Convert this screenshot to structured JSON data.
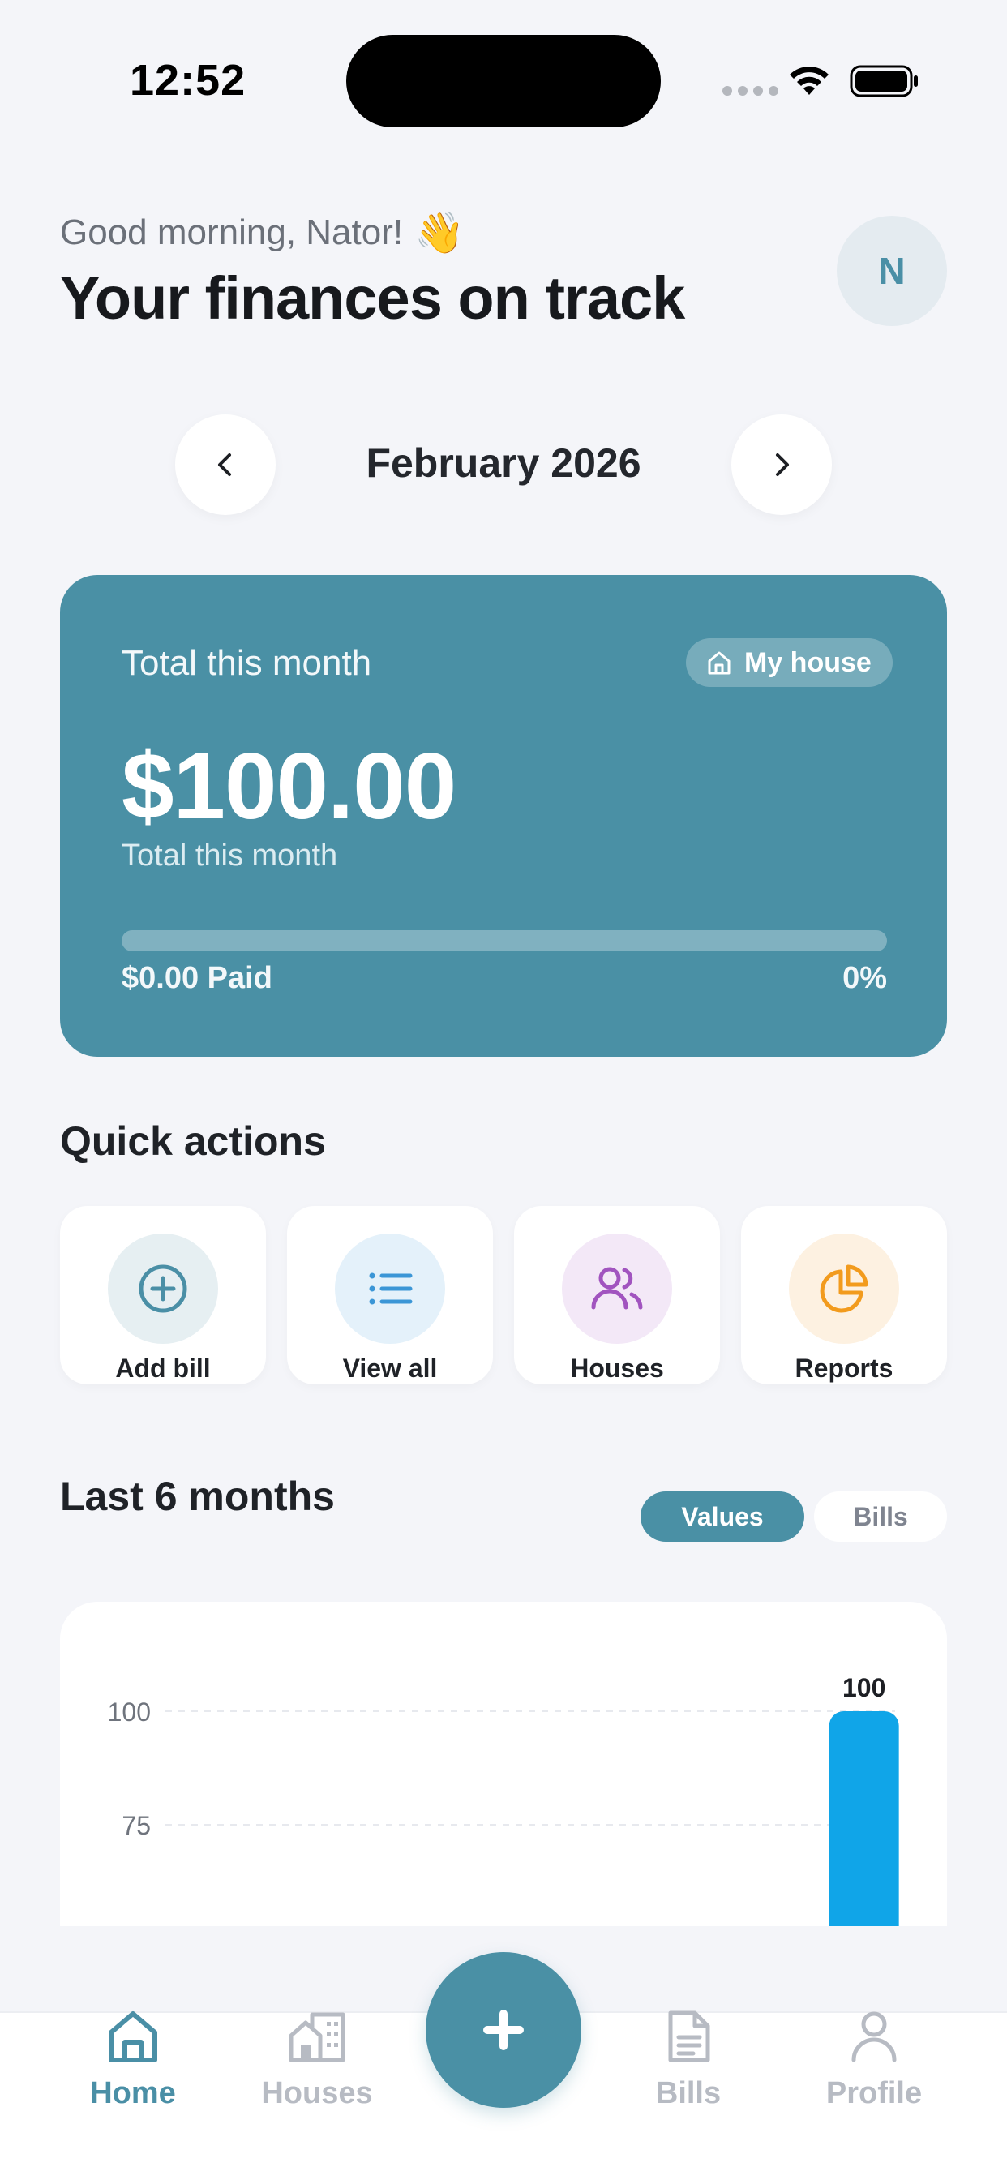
{
  "status_bar": {
    "time": "12:52"
  },
  "header": {
    "greeting": "Good morning, Nator!",
    "greeting_emoji": "👋",
    "title": "Your finances on track",
    "avatar_initial": "N"
  },
  "month_nav": {
    "label": "February 2026",
    "prev_icon": "chevron-left-icon",
    "next_icon": "chevron-right-icon"
  },
  "summary": {
    "label": "Total this month",
    "house_chip": "My house",
    "amount": "$100.00",
    "amount_sub": "Total this month",
    "paid_label": "$0.00 Paid",
    "paid_percent_label": "0%",
    "paid_fraction": 0
  },
  "quick_actions": {
    "title": "Quick actions",
    "items": [
      {
        "label": "Add bill",
        "icon": "plus-circle-icon",
        "color": "#4a8fa6",
        "bg": "#e6eff2"
      },
      {
        "label": "View all",
        "icon": "list-icon",
        "color": "#3b96d6",
        "bg": "#e4f1fa"
      },
      {
        "label": "Houses",
        "icon": "users-icon",
        "color": "#a154bf",
        "bg": "#f3e8f7"
      },
      {
        "label": "Reports",
        "icon": "pie-chart-icon",
        "color": "#f29b1d",
        "bg": "#fdf1e1"
      }
    ]
  },
  "chart_section": {
    "title": "Last 6 months",
    "toggle_values": "Values",
    "toggle_bills": "Bills",
    "active_toggle": "Values"
  },
  "chart_data": {
    "type": "bar",
    "categories": [
      "",
      "",
      "",
      "",
      "",
      ""
    ],
    "values": [
      0,
      0,
      0,
      0,
      0,
      100
    ],
    "data_labels": [
      "",
      "",
      "",
      "",
      "",
      "100"
    ],
    "y_ticks": [
      "100",
      "75"
    ],
    "ylim": [
      0,
      100
    ],
    "grid": true,
    "bar_color": "#10a5e8"
  },
  "bottom_nav": {
    "tabs": [
      {
        "label": "Home",
        "icon": "home-icon",
        "active": true
      },
      {
        "label": "Houses",
        "icon": "buildings-icon",
        "active": false
      },
      {
        "label": "Bills",
        "icon": "document-icon",
        "active": false
      },
      {
        "label": "Profile",
        "icon": "user-icon",
        "active": false
      }
    ],
    "fab_icon": "plus-icon"
  },
  "colors": {
    "accent": "#4a90a5",
    "background": "#f4f5f9",
    "bar": "#10a5e8"
  }
}
